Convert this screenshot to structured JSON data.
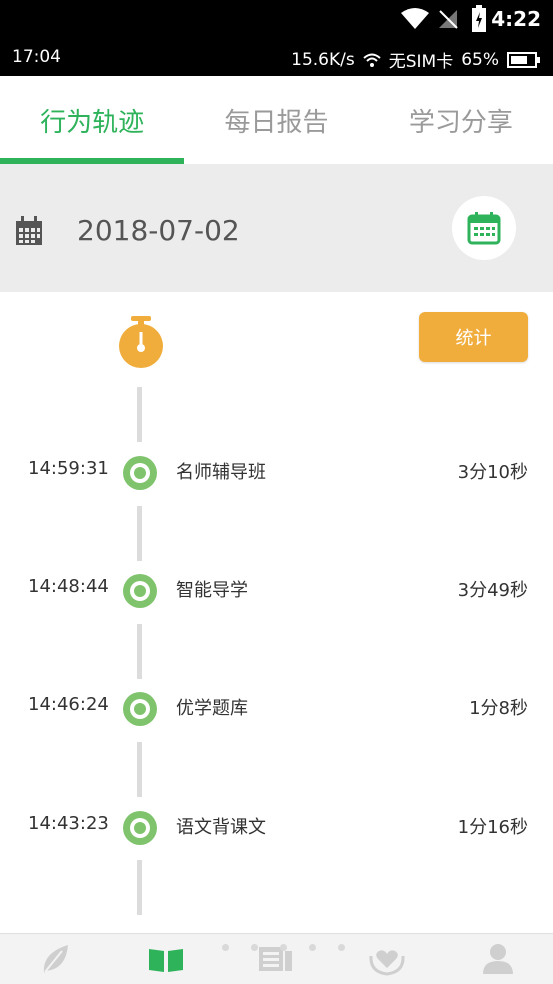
{
  "system": {
    "clock": "4:22"
  },
  "status": {
    "time": "17:04",
    "speed": "15.6K/s",
    "sim": "无SIM卡",
    "battery": "65%"
  },
  "tabs": [
    {
      "label": "行为轨迹",
      "active": true
    },
    {
      "label": "每日报告",
      "active": false
    },
    {
      "label": "学习分享",
      "active": false
    }
  ],
  "date": {
    "value": "2018-07-02"
  },
  "stat_button": "统计",
  "timeline": [
    {
      "time": "14:59:31",
      "name": "名师辅导班",
      "duration": "3分10秒"
    },
    {
      "time": "14:48:44",
      "name": "智能导学",
      "duration": "3分49秒"
    },
    {
      "time": "14:46:24",
      "name": "优学题库",
      "duration": "1分8秒"
    },
    {
      "time": "14:43:23",
      "name": "语文背课文",
      "duration": "1分16秒"
    }
  ],
  "colors": {
    "accent": "#2eb35b",
    "orange": "#f0ad3c",
    "dot": "#7fc36c"
  },
  "bottom_nav_icons": [
    "leaf-icon",
    "book-icon",
    "news-icon",
    "heart-hands-icon",
    "user-icon"
  ]
}
